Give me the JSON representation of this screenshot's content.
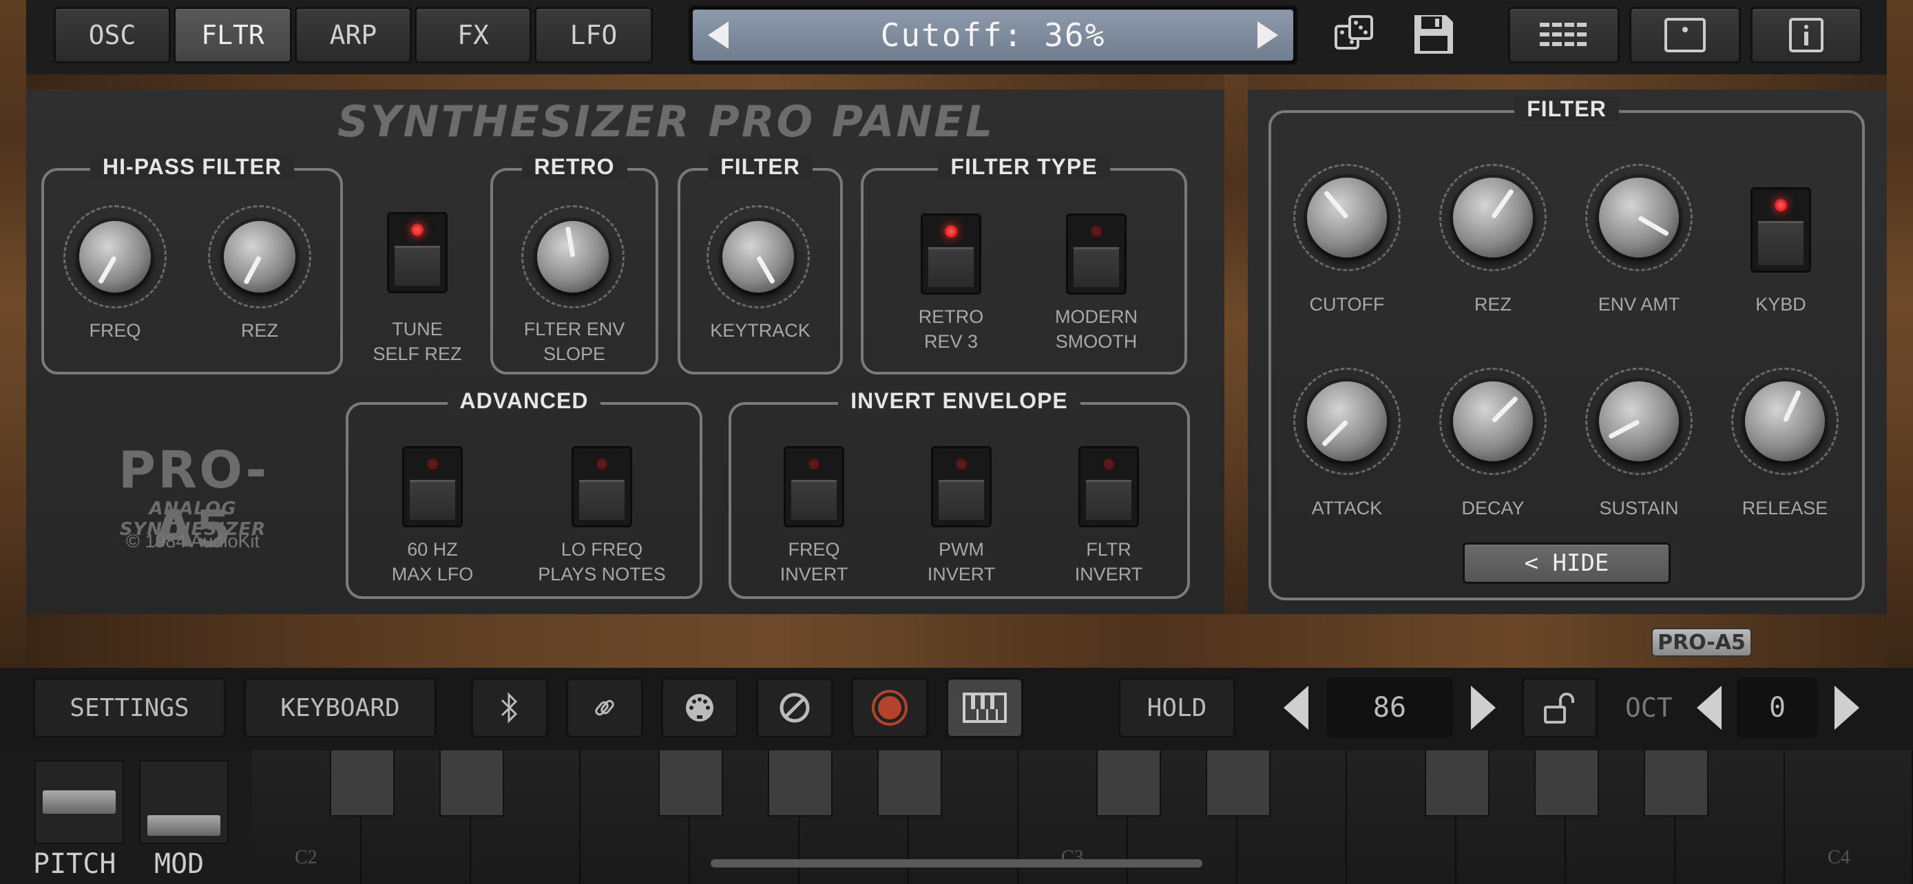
{
  "top_bar": {
    "tabs": [
      "OSC",
      "FLTR",
      "ARP",
      "FX",
      "LFO"
    ],
    "active_tab": "FLTR",
    "display_text": "Cutoff: 36%"
  },
  "main_panel": {
    "title": "SYNTHESIZER PRO PANEL",
    "logo": {
      "name": "PRO-A5",
      "subtitle": "ANALOG SYNTHESIZER",
      "copyright": "© 1984 AudioKit"
    },
    "hi_pass": {
      "title": "HI-PASS FILTER",
      "freq": "FREQ",
      "rez": "REZ"
    },
    "tune": {
      "line1": "TUNE",
      "line2": "SELF REZ"
    },
    "retro": {
      "title": "RETRO",
      "line1": "FLTER ENV",
      "line2": "SLOPE"
    },
    "filter": {
      "title": "FILTER",
      "keytrack": "KEYTRACK"
    },
    "filter_type": {
      "title": "FILTER TYPE",
      "retro1": "RETRO",
      "retro2": "REV 3",
      "modern1": "MODERN",
      "modern2": "SMOOTH"
    },
    "advanced": {
      "title": "ADVANCED",
      "a1": "60 HZ",
      "a2": "MAX LFO",
      "b1": "LO FREQ",
      "b2": "PLAYS NOTES"
    },
    "invert": {
      "title": "INVERT ENVELOPE",
      "f1": "FREQ",
      "f2": "INVERT",
      "p1": "PWM",
      "p2": "INVERT",
      "t1": "FLTR",
      "t2": "INVERT"
    }
  },
  "side_panel": {
    "title": "FILTER",
    "cutoff": "CUTOFF",
    "rez": "REZ",
    "env_amt": "ENV AMT",
    "kybd": "KYBD",
    "attack": "ATTACK",
    "decay": "DECAY",
    "sustain": "SUSTAIN",
    "release": "RELEASE",
    "hide": "< HIDE"
  },
  "wood_badge": "PRO-A5",
  "bottom_bar": {
    "settings": "SETTINGS",
    "keyboard": "KEYBOARD",
    "hold": "HOLD",
    "velocity": "86",
    "oct_label": "OCT",
    "octave": "0"
  },
  "wheels": {
    "pitch": "PITCH",
    "mod": "MOD"
  },
  "keys": {
    "c2": "C2",
    "c3": "C3",
    "c4": "C4"
  },
  "colors": {
    "led_on": "#ff2a2a",
    "panel": "#2b2b2b",
    "display": "#7f8ea0",
    "wood": "#5c3c22"
  }
}
